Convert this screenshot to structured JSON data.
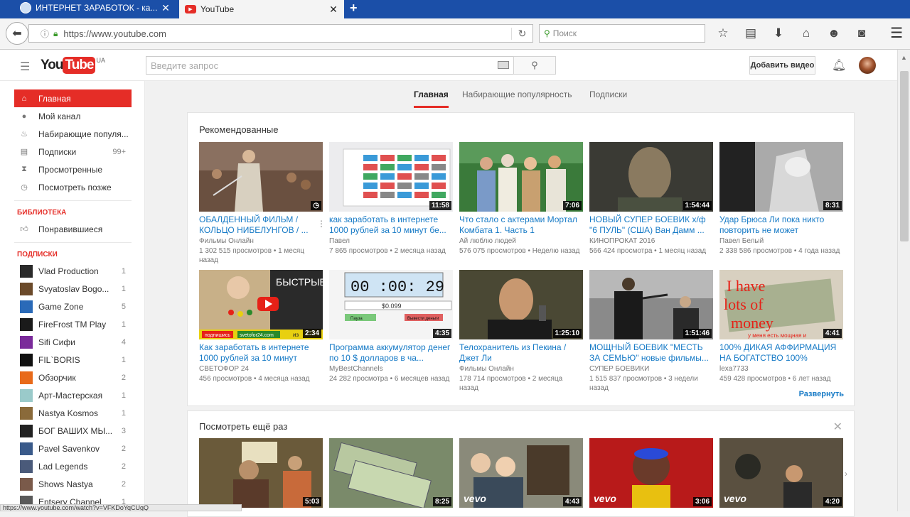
{
  "browser": {
    "tabs": [
      {
        "title": "ИНТЕРНЕТ ЗАРАБОТОК - ка..."
      },
      {
        "title": "YouTube"
      }
    ],
    "new_tab": "+",
    "url": "https://www.youtube.com",
    "search_placeholder": "Поиск",
    "status_url": "https://www.youtube.com/watch?v=VFKDoYqCUgQ"
  },
  "youtube": {
    "logo_you": "You",
    "logo_tube": "Tube",
    "region": "UA",
    "search_placeholder": "Введите запрос",
    "add_video": "Добавить видео",
    "tabs": [
      "Главная",
      "Набирающие популярность",
      "Подписки"
    ],
    "colors": {
      "brand": "#e52d27",
      "link": "#167ac6"
    }
  },
  "sidebar": {
    "main": [
      {
        "label": "Главная",
        "icon": "home-icon",
        "active": true
      },
      {
        "label": "Мой канал",
        "icon": "user-icon"
      },
      {
        "label": "Набирающие популя...",
        "icon": "flame-icon"
      },
      {
        "label": "Подписки",
        "icon": "subscriptions-icon",
        "count": "99+"
      },
      {
        "label": "Просмотренные",
        "icon": "hourglass-icon"
      },
      {
        "label": "Посмотреть позже",
        "icon": "clock-icon"
      }
    ],
    "library_heading": "БИБЛИОТЕКА",
    "library": [
      {
        "label": "Понравившиеся",
        "icon": "thumbs-up-icon"
      }
    ],
    "subs_heading": "ПОДПИСКИ",
    "subs": [
      {
        "label": "Vlad Production",
        "count": "1",
        "color": "#2a2a2a"
      },
      {
        "label": "Svyatoslav Bogo...",
        "count": "1",
        "color": "#6b4a2a"
      },
      {
        "label": "Game Zone",
        "count": "5",
        "color": "#2a6ab8"
      },
      {
        "label": "FireFrost TM Play",
        "count": "1",
        "color": "#1a1a1a"
      },
      {
        "label": "Sifi Сифи",
        "count": "4",
        "color": "#7a2a9a"
      },
      {
        "label": "FIL`BORIS",
        "count": "1",
        "color": "#111111"
      },
      {
        "label": "Обзорчик",
        "count": "2",
        "color": "#e86a1a"
      },
      {
        "label": "Арт-Мастерская",
        "count": "1",
        "color": "#9acaca"
      },
      {
        "label": "Nastya Kosmos",
        "count": "1",
        "color": "#8a6a3a"
      },
      {
        "label": "БОГ ВАШИХ МЫ...",
        "count": "3",
        "color": "#222222"
      },
      {
        "label": "Pavel Savenkov",
        "count": "2",
        "color": "#3a5a8a"
      },
      {
        "label": "Lad Legends",
        "count": "2",
        "color": "#4a5a7a"
      },
      {
        "label": "Shows Nastya",
        "count": "2",
        "color": "#7a5a4a"
      },
      {
        "label": "Entsery Channel",
        "count": "1",
        "color": "#5a5a5a"
      }
    ]
  },
  "recommended": {
    "title": "Рекомендованные",
    "expand": "Развернуть",
    "videos": [
      {
        "title": "ОБАЛДЕННЫЙ ФИЛЬМ / КОЛЬЦО НИБЕЛУНГОВ / ...",
        "channel": "Фильмы Онлайн",
        "meta": "1 302 515 просмотров  • 1 месяц назад",
        "duration": "",
        "bg": "#6a5040"
      },
      {
        "title": "как заработать в интернете 1000 рублей за 10 минут бе...",
        "channel": "Павел",
        "meta": "7 865 просмотров  • 2 месяца назад",
        "duration": "11:58",
        "bg": "#e8e8ea"
      },
      {
        "title": "Что стало с актерами Мортал Комбата 1. Часть 1",
        "channel": "Ай люблю людей",
        "meta": "576 075 просмотров  • Неделю назад",
        "duration": "7:06",
        "bg": "#3a6a3a"
      },
      {
        "title": "НОВЫЙ СУПЕР БОЕВИК х/ф \"6 ПУЛЬ\" (США) Ван Дамм ...",
        "channel": "КИНОПРОКАТ 2016",
        "meta": "566 424 просмотра  • 1 месяц назад",
        "duration": "1:54:44",
        "bg": "#4a4a40"
      },
      {
        "title": "Удар Брюса Ли пока никто повторить не может",
        "channel": "Павел Белый",
        "meta": "2 338 586 просмотров  • 4 года назад",
        "duration": "8:31",
        "bg": "#8a8a8a"
      },
      {
        "title": "Как заработать в интернете 1000 рублей за 10 минут",
        "channel": "СВЕТОФОР 24",
        "meta": "456 просмотров  • 4 месяца назад",
        "duration": "2:34",
        "bg": "#2a2a2a"
      },
      {
        "title": "Программа аккумулятор денег по 10 $ долларов в ча...",
        "channel": "MyBestChannels",
        "meta": "24 282 просмотра  • 6 месяцев назад",
        "duration": "4:35",
        "bg": "#f4f4f4"
      },
      {
        "title": "Телохранитель из Пекина / Джет Ли",
        "channel": "Фильмы Онлайн",
        "meta": "178 714 просмотров  • 2 месяца назад",
        "duration": "1:25:10",
        "bg": "#3a3a2a"
      },
      {
        "title": "МОЩНЫЙ БОЕВИК \"МЕСТЬ ЗА СЕМЬЮ\" новые фильмы...",
        "channel": "СУПЕР БОЕВИКИ",
        "meta": "1 515 837 просмотров  • 3 недели назад",
        "duration": "1:51:46",
        "bg": "#5a5a5a"
      },
      {
        "title": "100% ДИКАЯ АФФИРМАЦИЯ НА БОГАТСТВО 100%",
        "channel": "lexa7733",
        "meta": "459 428 просмотров  • 6 лет назад",
        "duration": "4:41",
        "bg": "#d8d0c0"
      }
    ],
    "thumb_texts": {
      "money_title": "БЫСТРЫЕ ДЕНЬГИ",
      "money_sub": "подпишись",
      "money_site": "svetofor24.com",
      "money_badge": "из",
      "timer": "00 :00: 29",
      "timer_amount": "$0.099",
      "timer_btn1": "Пауза",
      "timer_btn2": "Вывести деньги",
      "affirm1": "I have",
      "affirm2": "lots of",
      "affirm3": "money",
      "affirm_caption": "у меня есть мощная и"
    }
  },
  "watch_again": {
    "title": "Посмотреть ещё раз",
    "close": "✕",
    "vevo": "vevo",
    "videos": [
      {
        "duration": "5:03",
        "bg": "#6a5a3a"
      },
      {
        "duration": "8:25",
        "bg": "#7a8a6a"
      },
      {
        "duration": "4:43",
        "bg": "#6a6a5a"
      },
      {
        "duration": "3:06",
        "bg": "#b81a1a"
      },
      {
        "duration": "4:20",
        "bg": "#5a5040"
      }
    ]
  }
}
